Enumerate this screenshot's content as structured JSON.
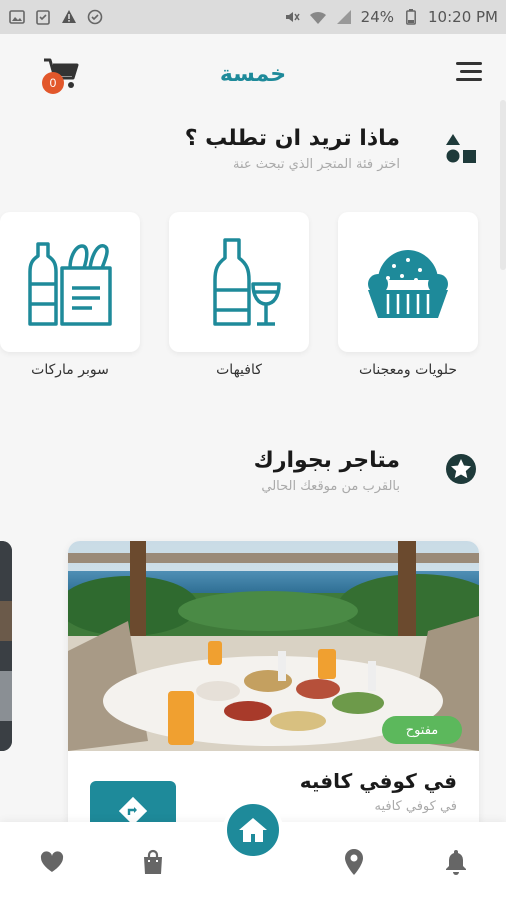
{
  "status_bar": {
    "battery": "24%",
    "time": "10:20 PM"
  },
  "header": {
    "brand": "خمسة",
    "cart_count": "0"
  },
  "categories_section": {
    "title": "ماذا تريد ان تطلب ؟",
    "subtitle": "اختر فئة المتجر الذي تبحث عنة",
    "items": [
      {
        "label": "حلويات ومعجنات",
        "icon": "pastry-icon"
      },
      {
        "label": "كافيهات",
        "icon": "drinks-icon"
      },
      {
        "label": "سوبر ماركات",
        "icon": "grocery-icon"
      }
    ]
  },
  "nearby_section": {
    "title": "متاجر بجوارك",
    "subtitle": "بالقرب من موقعك الحالي"
  },
  "store": {
    "name": "في كوفي كافيه",
    "subtitle": "في كوفي كافيه",
    "status": "مفتوح"
  },
  "bottom_nav": {
    "items": [
      "heart-icon",
      "bag-icon",
      "home-icon",
      "location-icon",
      "bell-icon"
    ]
  },
  "colors": {
    "primary": "#1e8a9a",
    "accent": "#e2572b",
    "open": "#5cb85c"
  }
}
